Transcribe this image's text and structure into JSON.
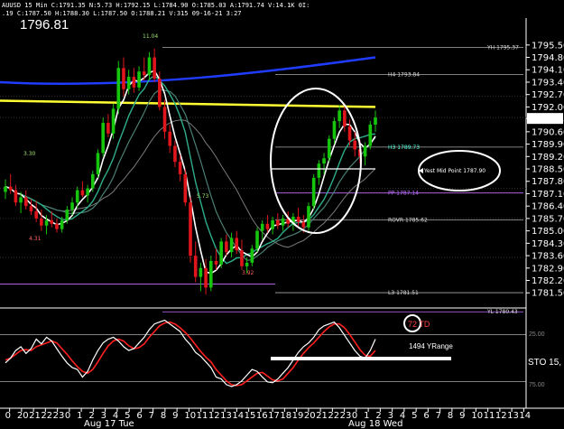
{
  "header": {
    "line1": "AUUSD  15 Min  C:1791.35  N:5.73  H:1792.15  L:1784.90  O:1785.03  A:1791.74  V:14.1K  0I:",
    "line2": ".19  C:1787.50  H:1788.30  L:1787.50  O:1788.21  V:315  09-16-21  3:27"
  },
  "big_price": "1796.81",
  "colors": {
    "background": "#000000",
    "up_candle": "#16c60c",
    "down_candle": "#e0161c",
    "blue_ma": "#1f3cff",
    "yellow_line": "#ffff33",
    "white_ma": "#ffffff",
    "green_ma": "#2fae8a",
    "teal_ma": "#4a7f74",
    "gray_ma": "#7a7a7a",
    "magenta": "#c070ff",
    "red_line": "#ff2020"
  },
  "price_axis": {
    "ticks": [
      "1795.50",
      "1794.80",
      "1794.10",
      "1793.40",
      "1792.70",
      "1792.00",
      "1791.35",
      "1790.60",
      "1789.90",
      "1789.20",
      "1788.50",
      "1787.80",
      "1787.10",
      "1786.40",
      "1785.70",
      "1785.00",
      "1784.30",
      "1783.60",
      "1782.90",
      "1782.20",
      "1781.50"
    ],
    "current": "1791.35",
    "ylim": [
      1780.9,
      1796.0
    ]
  },
  "pivot_labels": {
    "yh": "YH 1795.37",
    "h4": "H4 1793.84",
    "h3": "H3 1789.73",
    "pp": "PP 1787.14",
    "rovr": "ROVR 1785.62",
    "l3": "L3 1781.51",
    "yl": "YL 1780.43"
  },
  "annotations": {
    "hi_label": "11.04",
    "t330": "3.30",
    "t431": "4.31",
    "t573": "5.73",
    "t392": "3.92",
    "yest_mid": "Yest Mid Point 1787.90",
    "td": "72 TD",
    "yrange": "1494 YRange",
    "sto": "STO 15,",
    "osc_25": "25.00",
    "osc_75": "75.00"
  },
  "time_axis": {
    "hours": [
      "0",
      "20",
      "21",
      "22",
      "23",
      "0",
      "1",
      "2",
      "3",
      "4",
      "5",
      "6",
      "7",
      "8",
      "9",
      "10",
      "11",
      "12",
      "13",
      "14",
      "15",
      "16",
      "17",
      "18",
      "19",
      "20",
      "21",
      "22",
      "23",
      "0",
      "1",
      "2",
      "3",
      "4",
      "5",
      "6",
      "7",
      "8",
      "9",
      "10",
      "11",
      "12",
      "13",
      "14"
    ],
    "dates": [
      "Aug 17 Tue",
      "Aug 18 Wed"
    ]
  },
  "chart_data": {
    "type": "candlestick",
    "ylim": [
      1780.9,
      1796.0
    ],
    "candles": [
      [
        1787.2,
        1787.9,
        1786.8,
        1787.5
      ],
      [
        1787.5,
        1788.2,
        1787.1,
        1787.3
      ],
      [
        1787.3,
        1787.6,
        1786.4,
        1786.6
      ],
      [
        1786.6,
        1787.2,
        1786.0,
        1786.9
      ],
      [
        1786.9,
        1787.3,
        1786.2,
        1786.4
      ],
      [
        1786.4,
        1786.8,
        1785.9,
        1786.1
      ],
      [
        1786.1,
        1786.7,
        1785.5,
        1785.7
      ],
      [
        1785.7,
        1786.2,
        1785.0,
        1785.3
      ],
      [
        1785.3,
        1785.9,
        1784.8,
        1785.6
      ],
      [
        1785.6,
        1786.1,
        1785.2,
        1785.4
      ],
      [
        1785.4,
        1785.7,
        1784.9,
        1785.1
      ],
      [
        1785.1,
        1785.8,
        1784.9,
        1785.6
      ],
      [
        1785.6,
        1786.4,
        1785.4,
        1786.2
      ],
      [
        1786.2,
        1786.9,
        1785.9,
        1786.6
      ],
      [
        1786.6,
        1787.5,
        1786.3,
        1787.3
      ],
      [
        1787.3,
        1787.8,
        1786.9,
        1787.0
      ],
      [
        1787.0,
        1787.6,
        1786.6,
        1787.4
      ],
      [
        1787.4,
        1788.4,
        1787.2,
        1788.2
      ],
      [
        1788.2,
        1789.6,
        1788.0,
        1789.4
      ],
      [
        1789.4,
        1791.4,
        1789.2,
        1791.1
      ],
      [
        1791.1,
        1791.6,
        1790.3,
        1790.5
      ],
      [
        1790.5,
        1792.2,
        1790.2,
        1791.9
      ],
      [
        1791.9,
        1794.6,
        1791.6,
        1794.2
      ],
      [
        1794.2,
        1794.8,
        1792.6,
        1793.0
      ],
      [
        1793.0,
        1794.1,
        1792.7,
        1793.7
      ],
      [
        1793.7,
        1794.2,
        1792.8,
        1793.1
      ],
      [
        1793.1,
        1794.3,
        1792.9,
        1794.0
      ],
      [
        1794.0,
        1794.8,
        1793.5,
        1793.8
      ],
      [
        1793.8,
        1795.1,
        1793.5,
        1794.8
      ],
      [
        1794.8,
        1795.3,
        1793.4,
        1793.6
      ],
      [
        1793.6,
        1794.0,
        1791.8,
        1792.0
      ],
      [
        1792.0,
        1792.4,
        1790.2,
        1790.6
      ],
      [
        1790.6,
        1791.0,
        1789.4,
        1789.8
      ],
      [
        1789.8,
        1790.1,
        1788.6,
        1788.9
      ],
      [
        1788.9,
        1789.3,
        1787.8,
        1788.2
      ],
      [
        1788.2,
        1788.5,
        1786.4,
        1786.6
      ],
      [
        1786.6,
        1786.9,
        1783.2,
        1783.6
      ],
      [
        1783.6,
        1784.4,
        1782.1,
        1782.4
      ],
      [
        1782.4,
        1783.2,
        1781.6,
        1782.9
      ],
      [
        1782.9,
        1783.4,
        1781.4,
        1781.8
      ],
      [
        1781.8,
        1783.6,
        1781.6,
        1783.3
      ],
      [
        1783.3,
        1784.0,
        1782.8,
        1783.1
      ],
      [
        1783.1,
        1784.6,
        1782.9,
        1784.4
      ],
      [
        1784.4,
        1784.8,
        1783.6,
        1783.8
      ],
      [
        1783.8,
        1784.9,
        1783.5,
        1784.6
      ],
      [
        1784.6,
        1785.0,
        1783.7,
        1783.9
      ],
      [
        1783.9,
        1784.5,
        1782.8,
        1783.0
      ],
      [
        1783.0,
        1783.5,
        1782.6,
        1783.2
      ],
      [
        1783.2,
        1784.2,
        1783.0,
        1784.0
      ],
      [
        1784.0,
        1785.2,
        1783.8,
        1785.0
      ],
      [
        1785.0,
        1785.6,
        1784.5,
        1785.4
      ],
      [
        1785.4,
        1785.9,
        1784.9,
        1785.1
      ],
      [
        1785.1,
        1785.8,
        1784.8,
        1785.6
      ],
      [
        1785.6,
        1786.0,
        1785.1,
        1785.3
      ],
      [
        1785.3,
        1785.9,
        1785.0,
        1785.7
      ],
      [
        1785.7,
        1786.1,
        1785.2,
        1785.4
      ],
      [
        1785.4,
        1786.0,
        1785.0,
        1785.8
      ],
      [
        1785.8,
        1786.3,
        1785.3,
        1785.5
      ],
      [
        1785.5,
        1785.9,
        1784.9,
        1785.2
      ],
      [
        1785.2,
        1786.6,
        1785.0,
        1786.4
      ],
      [
        1786.4,
        1788.2,
        1786.2,
        1788.0
      ],
      [
        1788.0,
        1789.0,
        1787.6,
        1788.8
      ],
      [
        1788.8,
        1789.4,
        1788.2,
        1789.1
      ],
      [
        1789.1,
        1790.4,
        1788.9,
        1790.2
      ],
      [
        1790.2,
        1791.4,
        1789.9,
        1791.2
      ],
      [
        1791.2,
        1792.1,
        1790.8,
        1791.8
      ],
      [
        1791.8,
        1792.2,
        1790.6,
        1790.9
      ],
      [
        1790.9,
        1791.3,
        1789.8,
        1790.1
      ],
      [
        1790.1,
        1790.6,
        1789.2,
        1789.6
      ],
      [
        1789.6,
        1790.1,
        1788.8,
        1789.2
      ],
      [
        1789.2,
        1790.0,
        1788.7,
        1789.8
      ],
      [
        1789.8,
        1791.2,
        1789.6,
        1791.0
      ],
      [
        1791.0,
        1791.8,
        1790.6,
        1791.4
      ]
    ],
    "stochastic": {
      "k": [
        45,
        50,
        58,
        62,
        55,
        60,
        70,
        65,
        72,
        68,
        60,
        52,
        45,
        40,
        38,
        30,
        36,
        48,
        58,
        66,
        70,
        72,
        68,
        62,
        58,
        60,
        66,
        72,
        80,
        86,
        88,
        90,
        86,
        82,
        78,
        70,
        64,
        56,
        52,
        46,
        40,
        30,
        28,
        22,
        20,
        22,
        26,
        32,
        38,
        36,
        30,
        25,
        24,
        28,
        34,
        40,
        48,
        56,
        62,
        66,
        72,
        80,
        84,
        86,
        88,
        82,
        74,
        66,
        58,
        52,
        50,
        58,
        70
      ],
      "d": [
        48,
        50,
        54,
        58,
        59,
        58,
        62,
        64,
        66,
        68,
        66,
        60,
        54,
        47,
        41,
        36,
        34,
        38,
        46,
        55,
        63,
        68,
        70,
        68,
        63,
        60,
        61,
        65,
        72,
        78,
        84,
        87,
        88,
        86,
        82,
        77,
        71,
        64,
        57,
        51,
        46,
        38,
        32,
        26,
        22,
        21,
        22,
        26,
        30,
        34,
        35,
        31,
        27,
        26,
        28,
        34,
        40,
        48,
        55,
        61,
        66,
        72,
        78,
        83,
        86,
        86,
        82,
        75,
        67,
        59,
        53,
        52,
        58
      ]
    }
  }
}
